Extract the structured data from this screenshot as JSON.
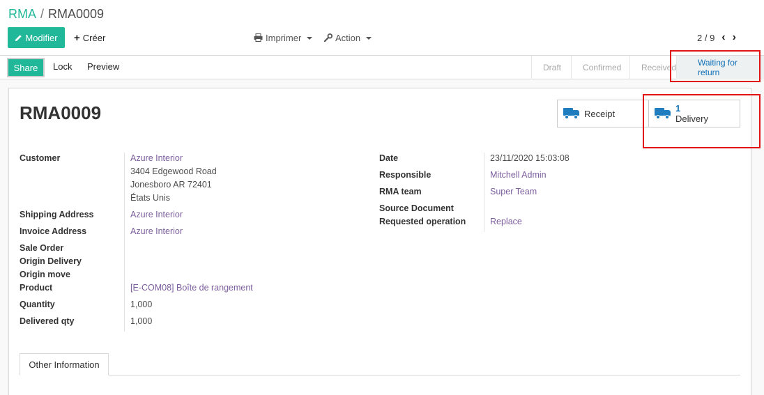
{
  "breadcrumb": {
    "parent": "RMA",
    "separator": "/",
    "current": "RMA0009"
  },
  "toolbar": {
    "edit_label": "Modifier",
    "create_label": "Créer",
    "print_label": "Imprimer",
    "action_label": "Action"
  },
  "pager": {
    "value": "2 / 9"
  },
  "statusbar": {
    "share_label": "Share",
    "lock_label": "Lock",
    "preview_label": "Preview",
    "stages": [
      "Draft",
      "Confirmed",
      "Received",
      "Waiting for return"
    ],
    "active_stage": "Waiting for return"
  },
  "record": {
    "title": "RMA0009",
    "smart_buttons": {
      "receipt_label": "Receipt",
      "delivery_count": "1",
      "delivery_label": "Delivery"
    },
    "left": {
      "customer_label": "Customer",
      "customer_name": "Azure Interior",
      "customer_address": [
        "3404 Edgewood Road",
        "Jonesboro AR 72401",
        "États Unis"
      ],
      "shipping_label": "Shipping Address",
      "shipping_value": "Azure Interior",
      "invoice_label": "Invoice Address",
      "invoice_value": "Azure Interior",
      "sale_order_label": "Sale Order",
      "origin_delivery_label": "Origin Delivery",
      "origin_move_label": "Origin move",
      "product_label": "Product",
      "product_value": "[E-COM08] Boîte de rangement",
      "quantity_label": "Quantity",
      "quantity_value": "1,000",
      "delivered_label": "Delivered qty",
      "delivered_value": "1,000"
    },
    "right": {
      "date_label": "Date",
      "date_value": "23/11/2020 15:03:08",
      "responsible_label": "Responsible",
      "responsible_value": "Mitchell Admin",
      "team_label": "RMA team",
      "team_value": "Super Team",
      "source_label": "Source Document",
      "operation_label": "Requested operation",
      "operation_value": "Replace"
    }
  },
  "tabs": {
    "other_info": "Other Information"
  },
  "colors": {
    "primary": "#21b799",
    "link": "#7c5e9e",
    "active_stage": "#0e6fb6",
    "highlight": "#e01414"
  },
  "icons": [
    "pencil-icon",
    "plus-icon",
    "printer-icon",
    "wrench-icon",
    "chevron-left-icon",
    "chevron-right-icon",
    "truck-icon"
  ]
}
